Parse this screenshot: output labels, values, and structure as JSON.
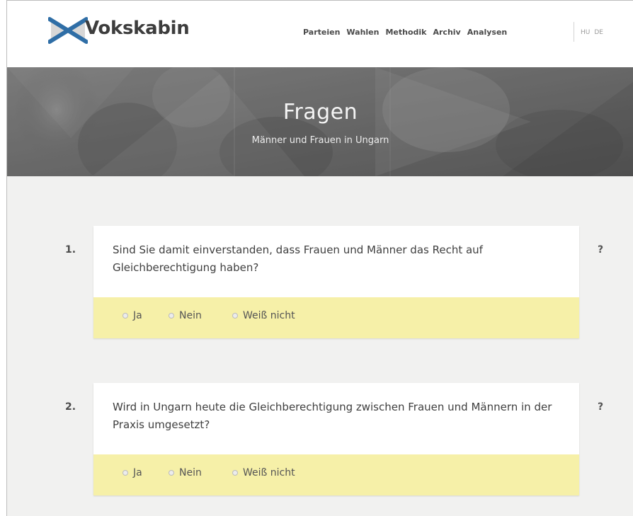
{
  "header": {
    "brand": "Vokskabin",
    "nav": [
      "Parteien",
      "Wahlen",
      "Methodik",
      "Archiv",
      "Analysen"
    ],
    "languages": [
      "HU",
      "DE"
    ]
  },
  "hero": {
    "title": "Fragen",
    "subtitle": "Männer und Frauen in Ungarn"
  },
  "questions": [
    {
      "number": "1.",
      "text": "Sind Sie damit einverstanden, dass Frauen und Männer das Recht auf Gleichberechtigung haben?",
      "help": "?",
      "options": [
        "Ja",
        "Nein",
        "Weiß nicht"
      ]
    },
    {
      "number": "2.",
      "text": "Wird in Ungarn heute die Gleichberechtigung zwischen Frauen und Männern in der Praxis umgesetzt?",
      "help": "?",
      "options": [
        "Ja",
        "Nein",
        "Weiß nicht"
      ]
    }
  ],
  "colors": {
    "answer_bar": "#f6f0a8",
    "hero_bg": "#6f6f6f",
    "logo_blue": "#2f6ea6"
  }
}
